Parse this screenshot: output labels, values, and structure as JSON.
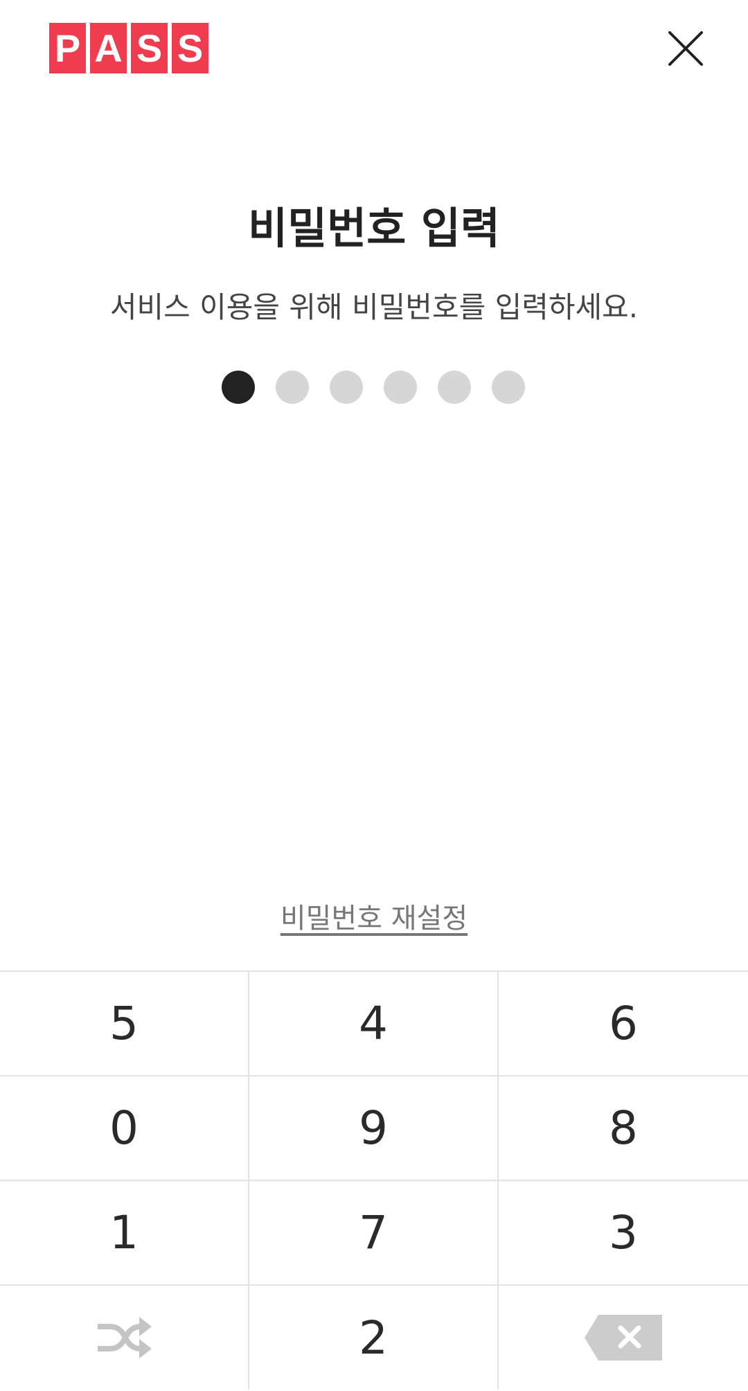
{
  "logo": {
    "letters": [
      "P",
      "A",
      "S",
      "S"
    ],
    "color": "#ef3c4e"
  },
  "header": {
    "close_icon": "close-icon"
  },
  "title": "비밀번호 입력",
  "subtitle": "서비스 이용을 위해 비밀번호를 입력하세요.",
  "pin": {
    "length": 6,
    "filled": 1
  },
  "reset_link": "비밀번호 재설정",
  "keypad": {
    "keys": [
      "5",
      "4",
      "6",
      "0",
      "9",
      "8",
      "1",
      "7",
      "3",
      "",
      "2",
      ""
    ],
    "shuffle_icon": "shuffle-icon",
    "backspace_icon": "backspace-icon"
  }
}
